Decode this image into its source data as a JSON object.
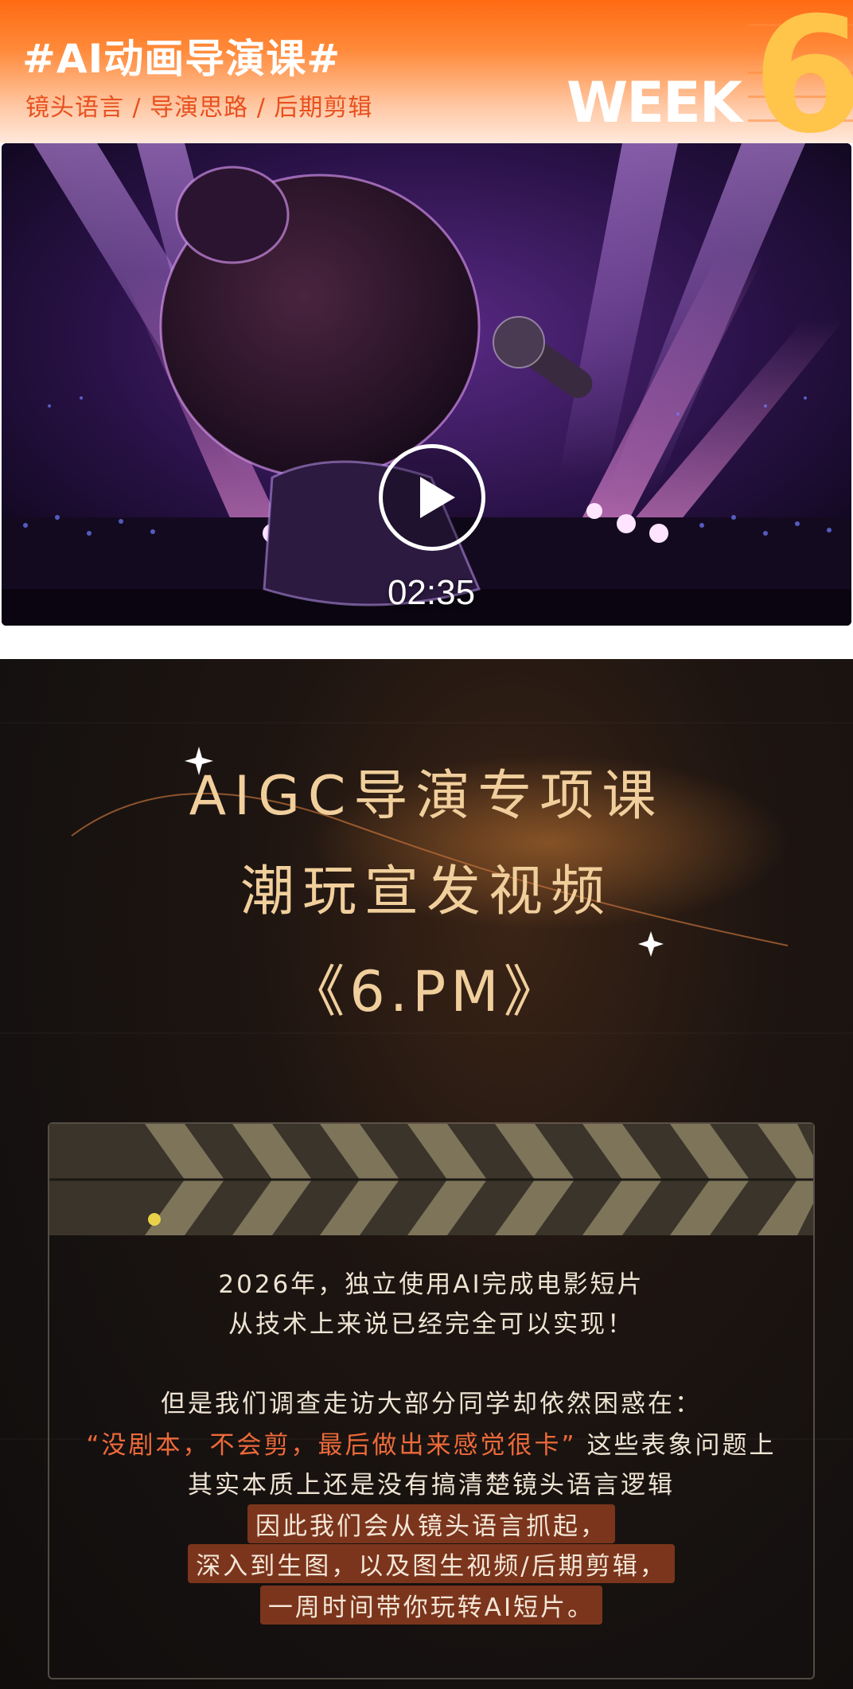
{
  "banner": {
    "title": "#AI动画导演课#",
    "subtitle": "镜头语言 / 导演思路 / 后期剪辑",
    "week_word": "WEEK",
    "week_number": "6"
  },
  "video": {
    "duration": "02:35",
    "play_icon": "play-icon"
  },
  "poster": {
    "title_line1": "AIGC导演专项课",
    "title_line2": "潮玩宣发视频",
    "title_line3": "《6.PM》",
    "body": {
      "line1": "2026年，独立使用AI完成电影短片",
      "line2": "从技术上来说已经完全可以实现！",
      "line3": "但是我们调查走访大部分同学却依然困惑在：",
      "line4_quote": "“没剧本，不会剪，最后做出来感觉很卡”",
      "line4_rest": "这些表象问题上",
      "line5": "其实本质上还是没有搞清楚镜头语言逻辑",
      "line6": "因此我们会从镜头语言抓起，",
      "line7": "深入到生图，以及图生视频/后期剪辑，",
      "line8": "一周时间带你玩转AI短片。"
    }
  },
  "colors": {
    "banner_orange": "#ff6a12",
    "subtitle_red": "#e8501e",
    "week_gold": "#ffc44a",
    "poster_gold": "#f1cf9c",
    "quote_red": "#ee6a3a",
    "highlight_bg": "#7b351c"
  }
}
